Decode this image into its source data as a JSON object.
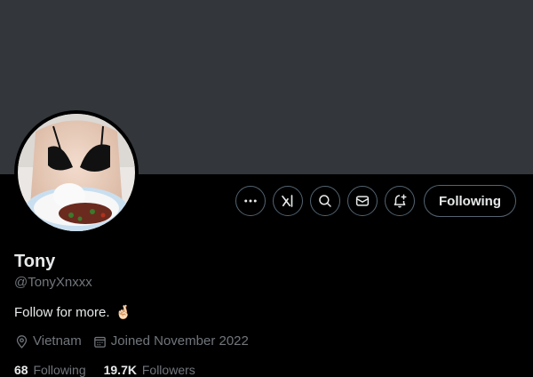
{
  "profile": {
    "display_name": "Tony",
    "handle": "@TonyXnxxx",
    "bio": "Follow for more.",
    "bio_emoji": "🤞🏻",
    "location": "Vietnam",
    "joined": "Joined November 2022",
    "following_count": "68",
    "following_label": "Following",
    "followers_count": "19.7K",
    "followers_label": "Followers"
  },
  "actions": {
    "more_icon": "more-horizontal-icon",
    "grok_icon": "grok-icon",
    "search_icon": "search-icon",
    "message_icon": "envelope-icon",
    "notify_icon": "bell-plus-icon",
    "following_button_label": "Following"
  },
  "colors": {
    "background": "#000000",
    "banner": "#33363a",
    "text_primary": "#e7e9ea",
    "text_secondary": "#71767b",
    "border": "#536471"
  }
}
